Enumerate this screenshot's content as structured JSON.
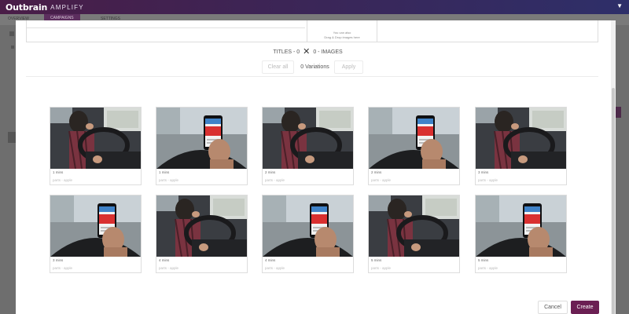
{
  "app": {
    "logo": "Outbrain",
    "product": "AMPLIFY"
  },
  "background": {
    "tabs": [
      "OVERVIEW",
      "CAMPAIGNS",
      "SETTINGS"
    ]
  },
  "upload": {
    "line1": "You can also",
    "line2": "Drag & Drop images here"
  },
  "counts": {
    "titles": "TITLES - 0",
    "images": "0 - IMAGES"
  },
  "actions": {
    "clear": "Clear all",
    "variations": "0 Variations",
    "apply": "Apply"
  },
  "images": [
    {
      "type": "driver",
      "meta": "1 mins",
      "src": "parts - apple"
    },
    {
      "type": "phone",
      "meta": "1 mins",
      "src": "parts - apple"
    },
    {
      "type": "driver",
      "meta": "2 mins",
      "src": "parts - apple"
    },
    {
      "type": "phone",
      "meta": "2 mins",
      "src": "parts - apple"
    },
    {
      "type": "driver",
      "meta": "3 mins",
      "src": "parts - apple"
    },
    {
      "type": "phone",
      "meta": "3 mins",
      "src": "parts - apple"
    },
    {
      "type": "driver",
      "meta": "4 mins",
      "src": "parts - apple"
    },
    {
      "type": "phone",
      "meta": "4 mins",
      "src": "parts - apple"
    },
    {
      "type": "driver",
      "meta": "5 mins",
      "src": "parts - apple"
    },
    {
      "type": "phone",
      "meta": "5 mins",
      "src": "parts - apple"
    }
  ],
  "footer": {
    "cancel": "Cancel",
    "create": "Create"
  },
  "colors": {
    "brand": "#6b1f53",
    "topbar": "#3c2556"
  }
}
